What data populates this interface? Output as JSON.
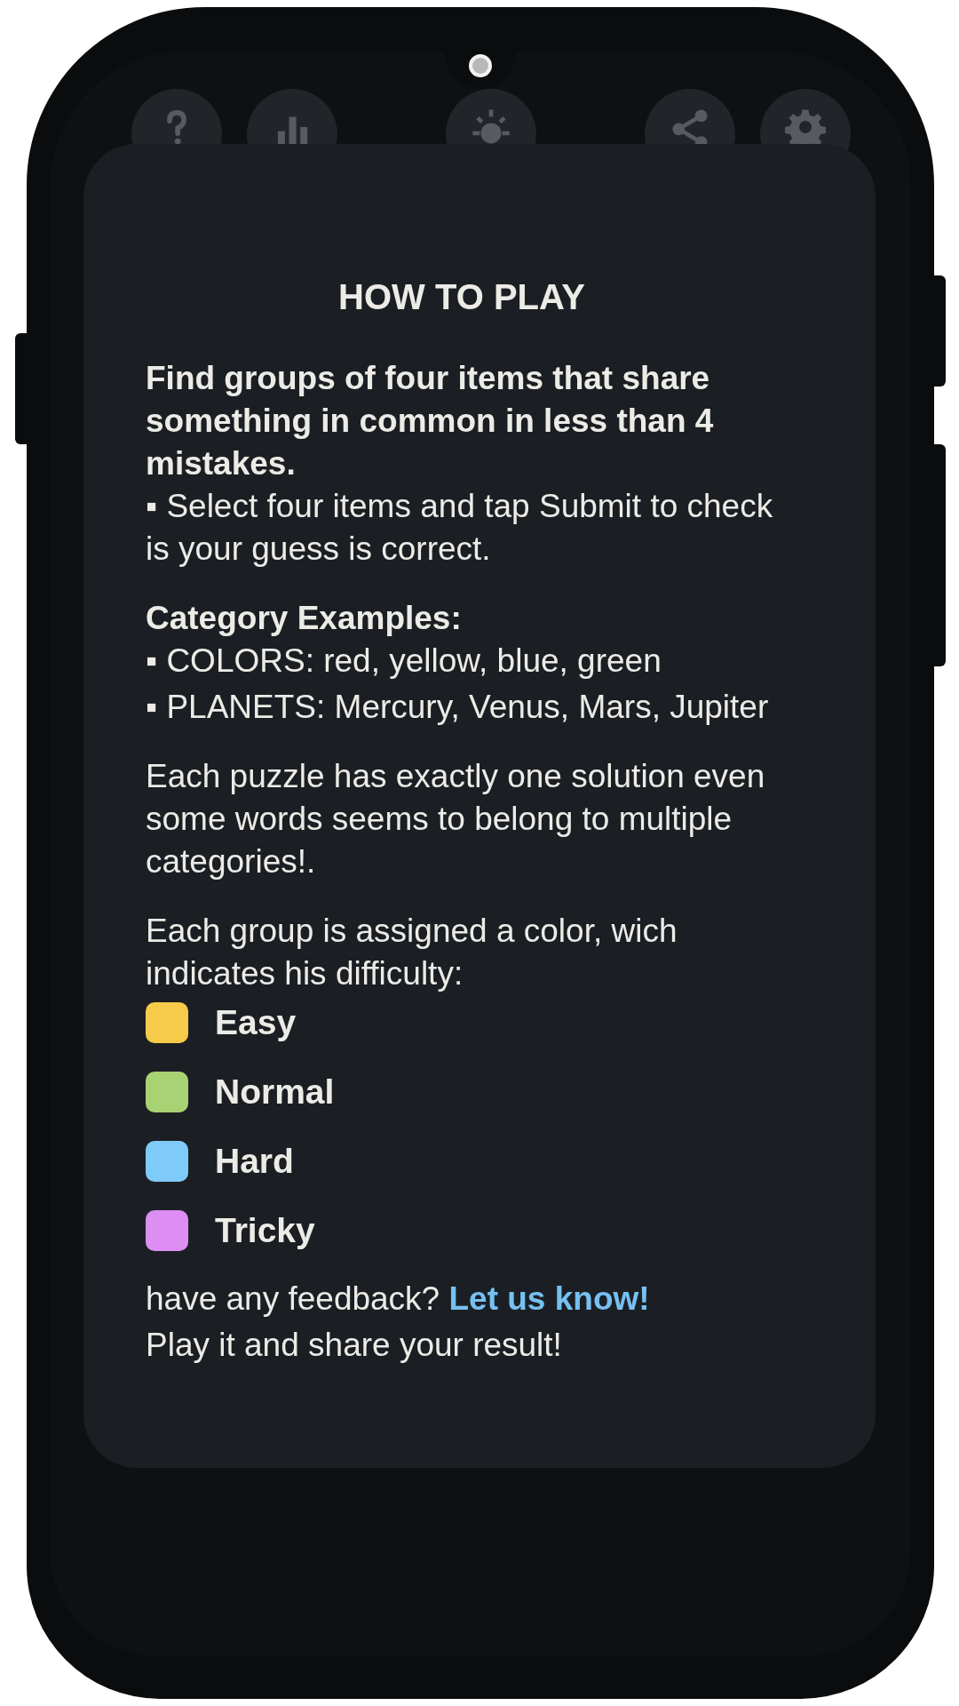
{
  "toolbar_buttons": [
    {
      "kind": "help"
    },
    {
      "kind": "stats"
    },
    {
      "kind": "theme"
    },
    {
      "kind": "share"
    },
    {
      "kind": "settings"
    }
  ],
  "dialog": {
    "title": "HOW TO PLAY",
    "rules": {
      "lead": "Find groups of four items that share something in common in less than 4 mistakes.",
      "bullets": [
        "▪ Select four items and tap Submit to check is your guess is correct."
      ]
    },
    "examples": {
      "heading": "Category Examples:",
      "bullets": [
        "▪ COLORS: red, yellow, blue, green",
        "▪ PLANETS: Mercury, Venus, Mars, Jupiter"
      ]
    },
    "note": "Each puzzle has exactly one solution even some words seems to belong to multiple categories!.",
    "difficulty": {
      "intro": "Each group is assigned a color, wich indicates his difficulty:",
      "levels": [
        {
          "label": "Easy",
          "color": "#f7cb4a"
        },
        {
          "label": "Normal",
          "color": "#a8d274"
        },
        {
          "label": "Hard",
          "color": "#7ecbfa"
        },
        {
          "label": "Tricky",
          "color": "#dc8ef3"
        }
      ]
    },
    "feedback": {
      "text": "have any feedback?",
      "link": "Let us know!"
    },
    "closing": "Play it and share your result!"
  }
}
